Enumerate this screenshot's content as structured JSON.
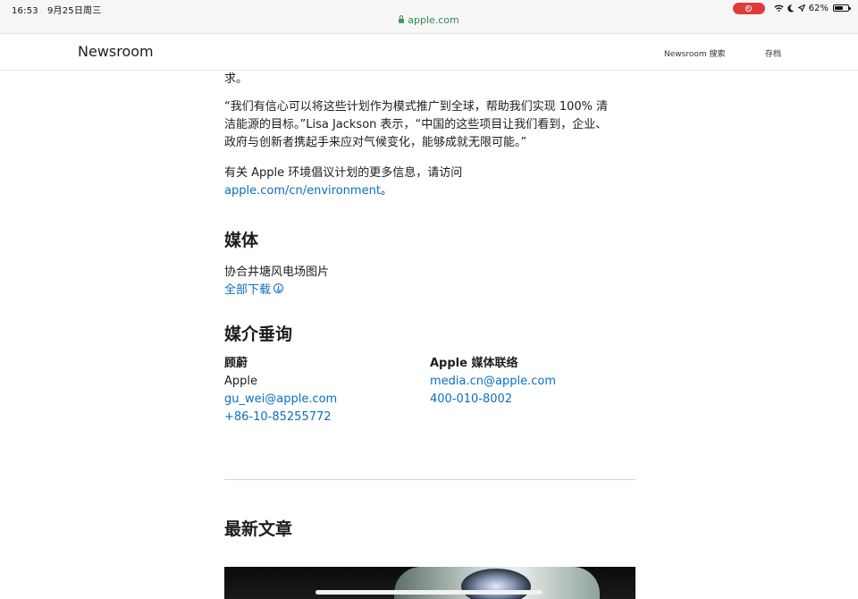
{
  "status_bar": {
    "time": "16:53",
    "date": "9月25日周三",
    "battery": "62%",
    "battery_level": 0.62
  },
  "url_bar": {
    "domain": "apple.com"
  },
  "nav": {
    "title": "Newsroom",
    "search_label": "Newsroom 搜索",
    "archive_label": "存档"
  },
  "article": {
    "para0": "求。",
    "quote_line1": "“我们有信心可以将这些计划作为模式推广到全球，帮助我们实现 100% 清",
    "quote_line2": "洁能源的目标。”Lisa Jackson 表示，“中国的这些项目让我们看到，企业、",
    "quote_line3": "政府与创新者携起手来应对气候变化，能够成就无限可能。”",
    "more_info_text": "有关 Apple 环境倡议计划的更多信息，请访问",
    "more_info_link": "apple.com/cn/environment",
    "more_info_end": "。"
  },
  "media": {
    "heading": "媒体",
    "item_label": "协合井塘风电场图片",
    "download_label": "全部下载"
  },
  "press": {
    "heading": "媒介垂询",
    "contact1": {
      "name": "顾蔚",
      "company": "Apple",
      "email": "gu_wei@apple.com",
      "phone": "+86-10-85255772"
    },
    "contact2": {
      "name": "Apple 媒体联络",
      "email": "media.cn@apple.com",
      "phone": "400-010-8002"
    }
  },
  "latest": {
    "heading": "最新文章"
  }
}
